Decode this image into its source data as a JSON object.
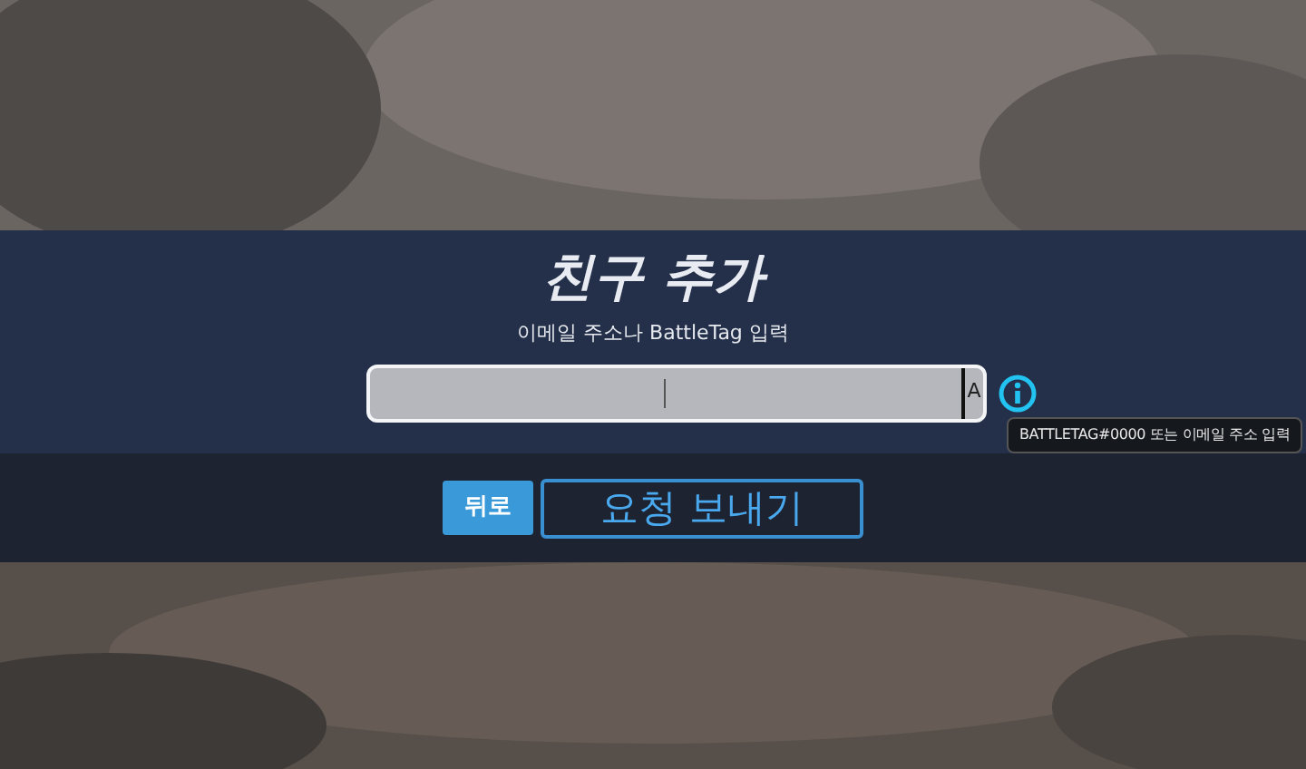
{
  "dialog": {
    "title": "친구 추가",
    "subtitle": "이메일 주소나 BattleTag 입력"
  },
  "field": {
    "input_mode": "A"
  },
  "tooltip": "BATTLETAG#0000 또는 이메일 주소 입력",
  "buttons": [
    {
      "label": "뒤로",
      "kind": "filled"
    },
    {
      "label": "요청 보내기",
      "kind": "outline"
    }
  ]
}
